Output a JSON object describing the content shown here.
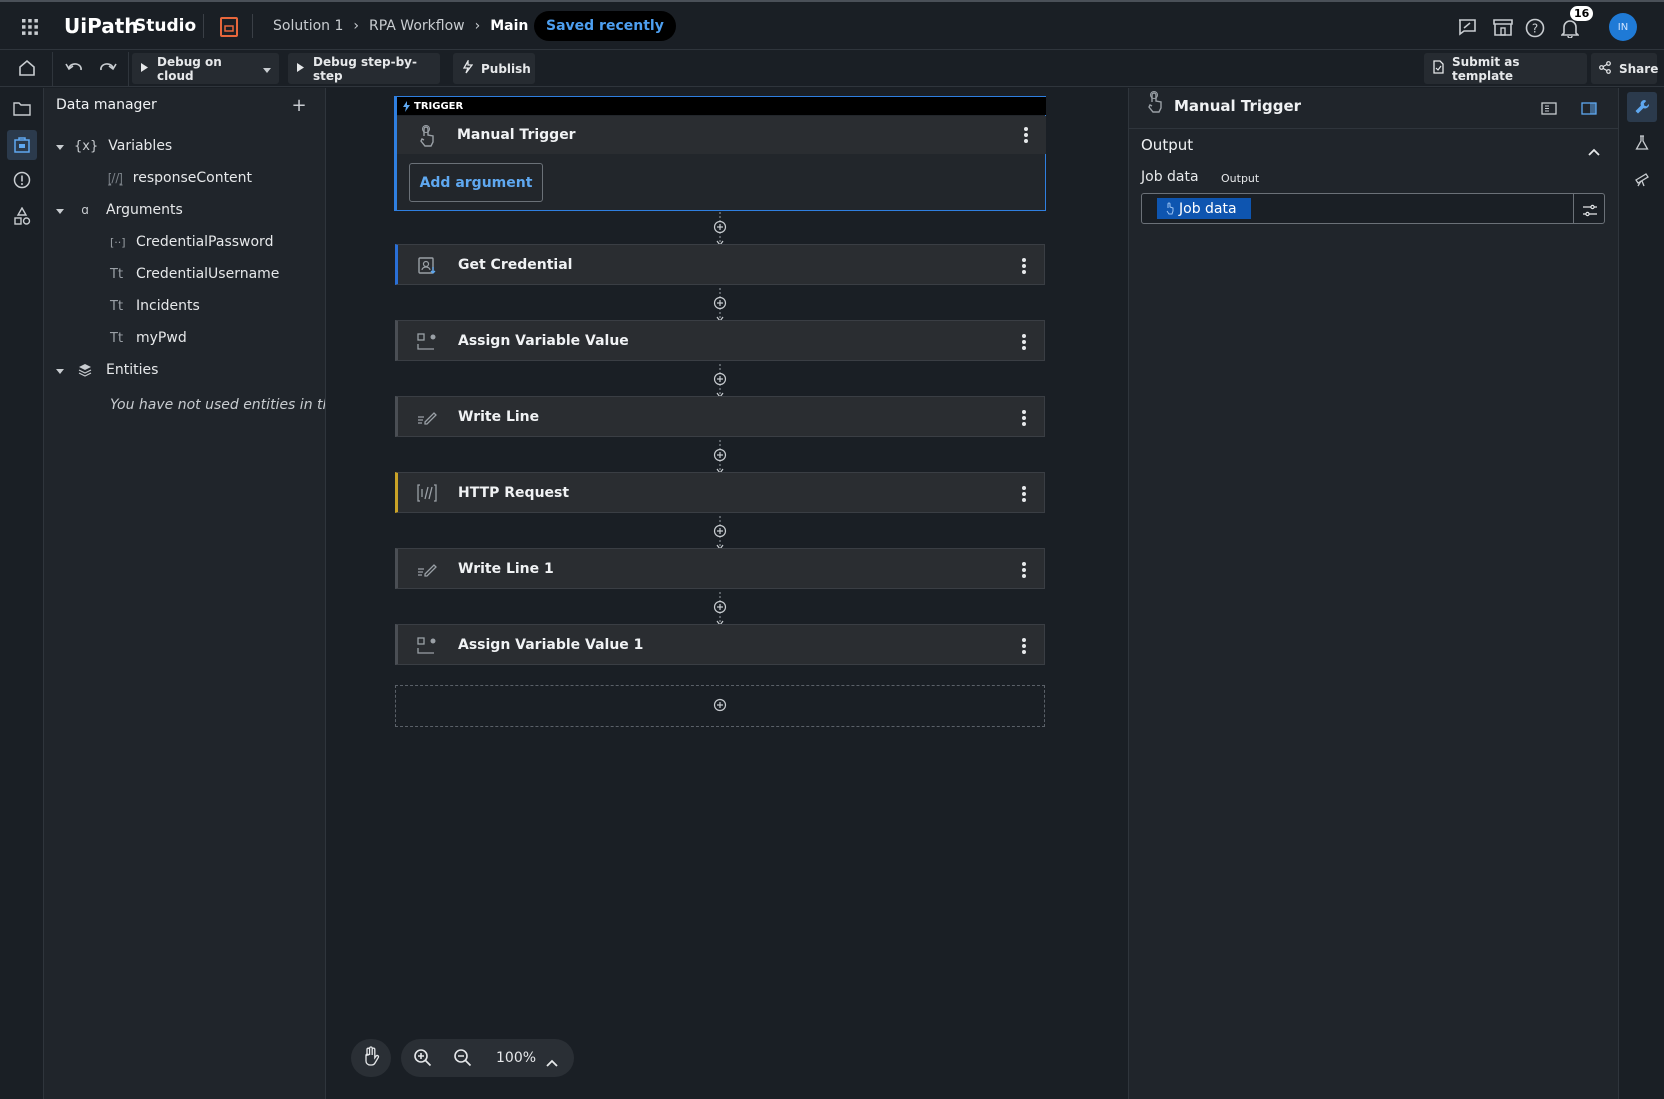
{
  "app": {
    "name": "UiPath",
    "product": "Studio"
  },
  "breadcrumb": {
    "items": [
      "Solution 1",
      "RPA Workflow",
      "Main"
    ],
    "status": "Saved recently"
  },
  "header": {
    "notifications_count": "16",
    "avatar_initials": "IN"
  },
  "toolbar": {
    "debug_cloud": "Debug on cloud",
    "debug_step": "Debug step-by-step",
    "publish": "Publish",
    "submit_template": "Submit as template",
    "share": "Share"
  },
  "data_manager": {
    "title": "Data manager",
    "variables_label": "Variables",
    "variables": [
      {
        "name": "responseContent",
        "icon": "http-response-icon"
      }
    ],
    "arguments_label": "Arguments",
    "arguments": [
      {
        "name": "CredentialPassword",
        "icon": "secure-string-icon"
      },
      {
        "name": "CredentialUsername",
        "icon": "text-type-icon"
      },
      {
        "name": "Incidents",
        "icon": "text-type-icon"
      },
      {
        "name": "myPwd",
        "icon": "text-type-icon"
      }
    ],
    "entities_label": "Entities",
    "entities_empty": "You have not used entities in th"
  },
  "workflow": {
    "trigger_tag": "TRIGGER",
    "trigger_name": "Manual Trigger",
    "add_argument": "Add argument",
    "activities": [
      {
        "name": "Get Credential",
        "accent": "#2a6fd6",
        "icon": "credential-icon"
      },
      {
        "name": "Assign Variable Value",
        "accent": "#4a4e54",
        "icon": "assign-icon"
      },
      {
        "name": "Write Line",
        "accent": "#4a4e54",
        "icon": "write-line-icon"
      },
      {
        "name": "HTTP Request",
        "accent": "#c9a227",
        "icon": "http-icon"
      },
      {
        "name": "Write Line 1",
        "accent": "#4a4e54",
        "icon": "write-line-icon"
      },
      {
        "name": "Assign Variable Value 1",
        "accent": "#4a4e54",
        "icon": "assign-icon"
      }
    ]
  },
  "zoom": {
    "level": "100%"
  },
  "properties": {
    "title": "Manual Trigger",
    "section": "Output",
    "field_label": "Job data",
    "field_tag": "Output",
    "field_value": "Job data"
  },
  "colors": {
    "accent": "#4d9ff0",
    "bg": "#1a1f25",
    "panel": "#20252b"
  }
}
